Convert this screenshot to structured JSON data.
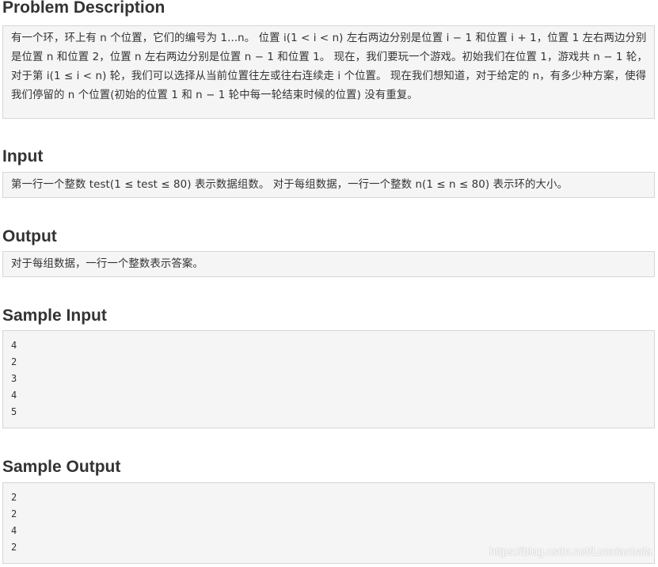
{
  "sections": {
    "problem_description": {
      "title": "Problem Description",
      "body": "有一个环，环上有 n 个位置，它们的编号为 1...n。 位置 i(1 < i < n) 左右两边分别是位置 i − 1 和位置 i + 1，位置 1 左右两边分别是位置 n 和位置 2，位置 n 左右两边分别是位置 n − 1 和位置 1。 现在，我们要玩一个游戏。初始我们在位置 1，游戏共 n − 1 轮，对于第 i(1 ≤ i < n) 轮，我们可以选择从当前位置往左或往右连续走 i 个位置。 现在我们想知道，对于给定的 n，有多少种方案，使得我们停留的 n 个位置(初始的位置 1 和 n − 1 轮中每一轮结束时候的位置) 没有重复。"
    },
    "input": {
      "title": "Input",
      "body": "第一行一个整数 test(1 ≤ test ≤ 80) 表示数据组数。 对于每组数据，一行一个整数 n(1 ≤ n ≤ 80) 表示环的大小。"
    },
    "output": {
      "title": "Output",
      "body": "对于每组数据，一行一个整数表示答案。"
    },
    "sample_input": {
      "title": "Sample Input",
      "lines": [
        "4",
        "2",
        "3",
        "4",
        "5"
      ]
    },
    "sample_output": {
      "title": "Sample Output",
      "lines": [
        "2",
        "2",
        "4",
        "2"
      ]
    }
  },
  "watermark": "https://blog.csdn.net/Luoxiaobaia"
}
